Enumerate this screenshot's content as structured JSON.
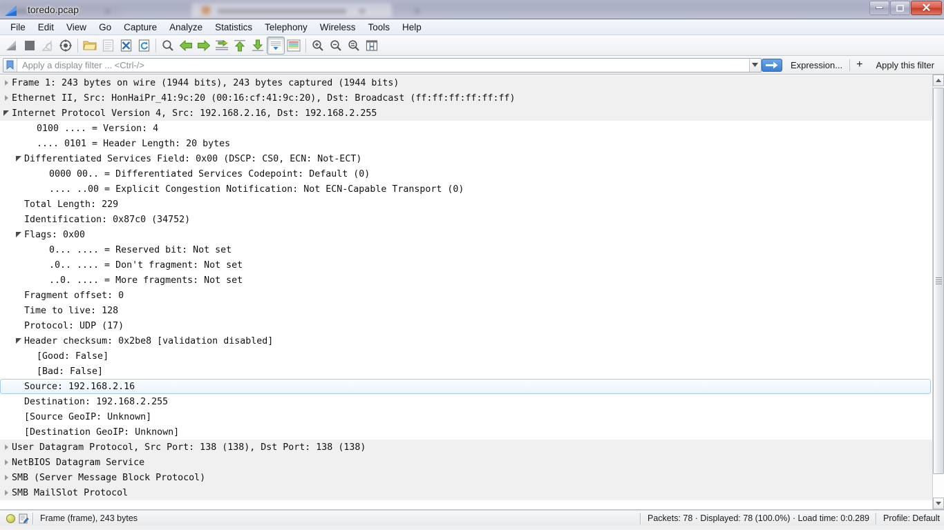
{
  "window": {
    "title": "toredo.pcap",
    "app_icon": "wireshark-sharkfin-icon",
    "controls": {
      "minimize": "minimize-button",
      "restore": "restore-button",
      "close": "✕"
    }
  },
  "menubar": {
    "items": [
      {
        "label": "File"
      },
      {
        "label": "Edit"
      },
      {
        "label": "View"
      },
      {
        "label": "Go"
      },
      {
        "label": "Capture"
      },
      {
        "label": "Analyze"
      },
      {
        "label": "Statistics"
      },
      {
        "label": "Telephony"
      },
      {
        "label": "Wireless"
      },
      {
        "label": "Tools"
      },
      {
        "label": "Help"
      }
    ]
  },
  "toolbar": {
    "items": [
      {
        "name": "start-capture-icon",
        "title": "Start capturing packets"
      },
      {
        "name": "stop-capture-icon",
        "title": "Stop capturing packets"
      },
      {
        "name": "restart-capture-icon",
        "title": "Restart current capture"
      },
      {
        "name": "capture-options-icon",
        "title": "Capture options"
      },
      {
        "name": "open-file-icon",
        "title": "Open a capture file"
      },
      {
        "name": "save-file-icon",
        "title": "Save this capture file"
      },
      {
        "name": "close-file-icon",
        "title": "Close this capture file"
      },
      {
        "name": "reload-file-icon",
        "title": "Reload this file"
      },
      {
        "name": "find-packet-icon",
        "title": "Find a packet"
      },
      {
        "name": "go-back-icon",
        "title": "Go back in packet history"
      },
      {
        "name": "go-forward-icon",
        "title": "Go forward in packet history"
      },
      {
        "name": "go-to-packet-icon",
        "title": "Go to specific packet"
      },
      {
        "name": "go-first-packet-icon",
        "title": "Go to first packet"
      },
      {
        "name": "go-last-packet-icon",
        "title": "Go to last packet"
      },
      {
        "name": "auto-scroll-icon",
        "title": "Auto scroll in live capture"
      },
      {
        "name": "colorize-icon",
        "title": "Colorize packet list"
      },
      {
        "name": "zoom-in-icon",
        "title": "Zoom in"
      },
      {
        "name": "zoom-out-icon",
        "title": "Zoom out"
      },
      {
        "name": "zoom-reset-icon",
        "title": "Normal size"
      },
      {
        "name": "resize-columns-icon",
        "title": "Resize columns"
      }
    ]
  },
  "filterbar": {
    "bookmark_icon": "bookmark-icon",
    "placeholder": "Apply a display filter ... <Ctrl-/>",
    "value": "",
    "apply_arrow": "→",
    "dropdown": "▾",
    "expression_label": "Expression...",
    "plus_label": "+",
    "apply_filter_label": "Apply this filter"
  },
  "tree": {
    "rows": [
      {
        "indent": 0,
        "state": "collapsed",
        "band": true,
        "text": "Frame 1: 243 bytes on wire (1944 bits), 243 bytes captured (1944 bits)"
      },
      {
        "indent": 0,
        "state": "collapsed",
        "band": true,
        "text": "Ethernet II, Src: HonHaiPr_41:9c:20 (00:16:cf:41:9c:20), Dst: Broadcast (ff:ff:ff:ff:ff:ff)"
      },
      {
        "indent": 0,
        "state": "expanded",
        "band": true,
        "text": "Internet Protocol Version 4, Src: 192.168.2.16, Dst: 192.168.2.255"
      },
      {
        "indent": 2,
        "state": "none",
        "band": false,
        "text": "0100 .... = Version: 4"
      },
      {
        "indent": 2,
        "state": "none",
        "band": false,
        "text": ".... 0101 = Header Length: 20 bytes"
      },
      {
        "indent": 1,
        "state": "expanded",
        "band": false,
        "text": "Differentiated Services Field: 0x00 (DSCP: CS0, ECN: Not-ECT)"
      },
      {
        "indent": 3,
        "state": "none",
        "band": false,
        "text": "0000 00.. = Differentiated Services Codepoint: Default (0)"
      },
      {
        "indent": 3,
        "state": "none",
        "band": false,
        "text": ".... ..00 = Explicit Congestion Notification: Not ECN-Capable Transport (0)"
      },
      {
        "indent": 1,
        "state": "none",
        "band": false,
        "text": "Total Length: 229"
      },
      {
        "indent": 1,
        "state": "none",
        "band": false,
        "text": "Identification: 0x87c0 (34752)"
      },
      {
        "indent": 1,
        "state": "expanded",
        "band": false,
        "text": "Flags: 0x00"
      },
      {
        "indent": 3,
        "state": "none",
        "band": false,
        "text": "0... .... = Reserved bit: Not set"
      },
      {
        "indent": 3,
        "state": "none",
        "band": false,
        "text": ".0.. .... = Don't fragment: Not set"
      },
      {
        "indent": 3,
        "state": "none",
        "band": false,
        "text": "..0. .... = More fragments: Not set"
      },
      {
        "indent": 1,
        "state": "none",
        "band": false,
        "text": "Fragment offset: 0"
      },
      {
        "indent": 1,
        "state": "none",
        "band": false,
        "text": "Time to live: 128"
      },
      {
        "indent": 1,
        "state": "none",
        "band": false,
        "text": "Protocol: UDP (17)"
      },
      {
        "indent": 1,
        "state": "expanded",
        "band": false,
        "text": "Header checksum: 0x2be8 [validation disabled]"
      },
      {
        "indent": 2,
        "state": "none",
        "band": false,
        "text": "[Good: False]"
      },
      {
        "indent": 2,
        "state": "none",
        "band": false,
        "text": "[Bad: False]"
      },
      {
        "indent": 1,
        "state": "none",
        "band": false,
        "selected": true,
        "text": "Source: 192.168.2.16"
      },
      {
        "indent": 1,
        "state": "none",
        "band": false,
        "text": "Destination: 192.168.2.255"
      },
      {
        "indent": 1,
        "state": "none",
        "band": false,
        "text": "[Source GeoIP: Unknown]"
      },
      {
        "indent": 1,
        "state": "none",
        "band": false,
        "text": "[Destination GeoIP: Unknown]"
      },
      {
        "indent": 0,
        "state": "collapsed",
        "band": true,
        "text": "User Datagram Protocol, Src Port: 138 (138), Dst Port: 138 (138)"
      },
      {
        "indent": 0,
        "state": "collapsed",
        "band": true,
        "text": "NetBIOS Datagram Service"
      },
      {
        "indent": 0,
        "state": "collapsed",
        "band": true,
        "text": "SMB (Server Message Block Protocol)"
      },
      {
        "indent": 0,
        "state": "collapsed",
        "band": true,
        "text": "SMB MailSlot Protocol"
      }
    ]
  },
  "statusbar": {
    "expert_icon": "expert-info-icon",
    "note_icon": "capture-comment-icon",
    "field_info": "Frame (frame), 243 bytes",
    "packet_counts": "Packets: 78 · Displayed: 78 (100.0%) · Load time: 0:0.289",
    "profile": "Profile: Default"
  }
}
